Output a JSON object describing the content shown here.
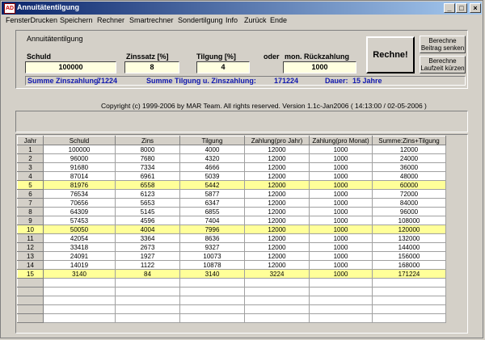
{
  "window": {
    "title": "Annuitätentilgung",
    "app_icon": "AD"
  },
  "menu": [
    "FensterDrucken",
    "Speichern",
    "Rechner",
    "Smartrechner",
    "Sondertilgung",
    "Info",
    "Zurück",
    "Ende"
  ],
  "input_panel": {
    "group_title": "Annuitätentilgung",
    "schuld_label": "Schuld",
    "schuld_value": "100000",
    "zinssatz_label": "Zinssatz [%]",
    "zinssatz_value": "8",
    "tilgung_label": "Tilgung [%]",
    "tilgung_value": "4",
    "oder_label": "oder",
    "rueckzahlung_label": "mon. Rückzahlung",
    "rueckzahlung_value": "1000",
    "rechne_label": "Rechne!",
    "beitrag_senken_line1": "Berechne",
    "beitrag_senken_line2": "Beitrag senken",
    "laufzeit_line1": "Berechne",
    "laufzeit_line2": "Laufzeit kürzen"
  },
  "summary": {
    "zins_label": "Summe Zinszahlung:",
    "zins_value": "71224",
    "tilgung_label": "Summe Tilgung u. Zinszahlung:",
    "tilgung_value": "171224",
    "dauer_label": "Dauer:",
    "dauer_value": "15 Jahre"
  },
  "copyright": "Copyright (c) 1999-2006 by MAR Team. All rights reserved.  Version 1.1c-Jan2006  ( 14:13:00 / 02-05-2006 )",
  "table": {
    "headers": [
      "Jahr",
      "Schuld",
      "Zins",
      "Tilgung",
      "Zahlung(pro Jahr)",
      "Zahlung(pro Monat)",
      "Summe:Zins+Tilgung"
    ],
    "rows": [
      [
        "1",
        "100000",
        "8000",
        "4000",
        "12000",
        "1000",
        "12000"
      ],
      [
        "2",
        "96000",
        "7680",
        "4320",
        "12000",
        "1000",
        "24000"
      ],
      [
        "3",
        "91680",
        "7334",
        "4666",
        "12000",
        "1000",
        "36000"
      ],
      [
        "4",
        "87014",
        "6961",
        "5039",
        "12000",
        "1000",
        "48000"
      ],
      [
        "5",
        "81976",
        "6558",
        "5442",
        "12000",
        "1000",
        "60000"
      ],
      [
        "6",
        "76534",
        "6123",
        "5877",
        "12000",
        "1000",
        "72000"
      ],
      [
        "7",
        "70656",
        "5653",
        "6347",
        "12000",
        "1000",
        "84000"
      ],
      [
        "8",
        "64309",
        "5145",
        "6855",
        "12000",
        "1000",
        "96000"
      ],
      [
        "9",
        "57453",
        "4596",
        "7404",
        "12000",
        "1000",
        "108000"
      ],
      [
        "10",
        "50050",
        "4004",
        "7996",
        "12000",
        "1000",
        "120000"
      ],
      [
        "11",
        "42054",
        "3364",
        "8636",
        "12000",
        "1000",
        "132000"
      ],
      [
        "12",
        "33418",
        "2673",
        "9327",
        "12000",
        "1000",
        "144000"
      ],
      [
        "13",
        "24091",
        "1927",
        "10073",
        "12000",
        "1000",
        "156000"
      ],
      [
        "14",
        "14019",
        "1122",
        "10878",
        "12000",
        "1000",
        "168000"
      ],
      [
        "15",
        "3140",
        "84",
        "3140",
        "3224",
        "1000",
        "171224"
      ]
    ],
    "highlight_years": [
      "5",
      "10",
      "15"
    ],
    "empty_rows": 5,
    "highlight_color": "#ffff99"
  },
  "colors": {
    "title_bar": "#0a246a",
    "summary_text": "#1018b0",
    "field_bg": "#ffffe0"
  }
}
